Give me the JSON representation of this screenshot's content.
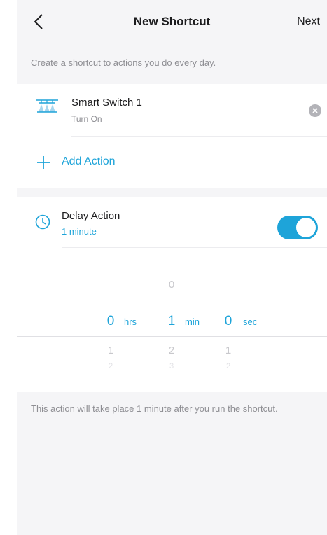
{
  "header": {
    "title": "New Shortcut",
    "next_label": "Next"
  },
  "subtitle": "Create a shortcut to actions you do every day.",
  "actions": {
    "device": {
      "name": "Smart Switch 1",
      "action": "Turn On",
      "icon": "light-switch-icon"
    },
    "add_label": "Add Action"
  },
  "delay": {
    "title": "Delay Action",
    "value": "1 minute",
    "enabled": true,
    "picker": {
      "hours": {
        "above": "",
        "selected": "0",
        "below": "1",
        "below2": "2",
        "unit": "hrs"
      },
      "minutes": {
        "above": "0",
        "selected": "1",
        "below": "2",
        "below2": "3",
        "unit": "min"
      },
      "seconds": {
        "above": "",
        "selected": "0",
        "below": "1",
        "below2": "2",
        "unit": "sec"
      }
    }
  },
  "footnote": "This action will take place 1 minute after you run the shortcut.",
  "colors": {
    "accent": "#1ea4d9",
    "background": "#f5f5f7",
    "card": "#ffffff",
    "muted_text": "#8e8e93"
  }
}
